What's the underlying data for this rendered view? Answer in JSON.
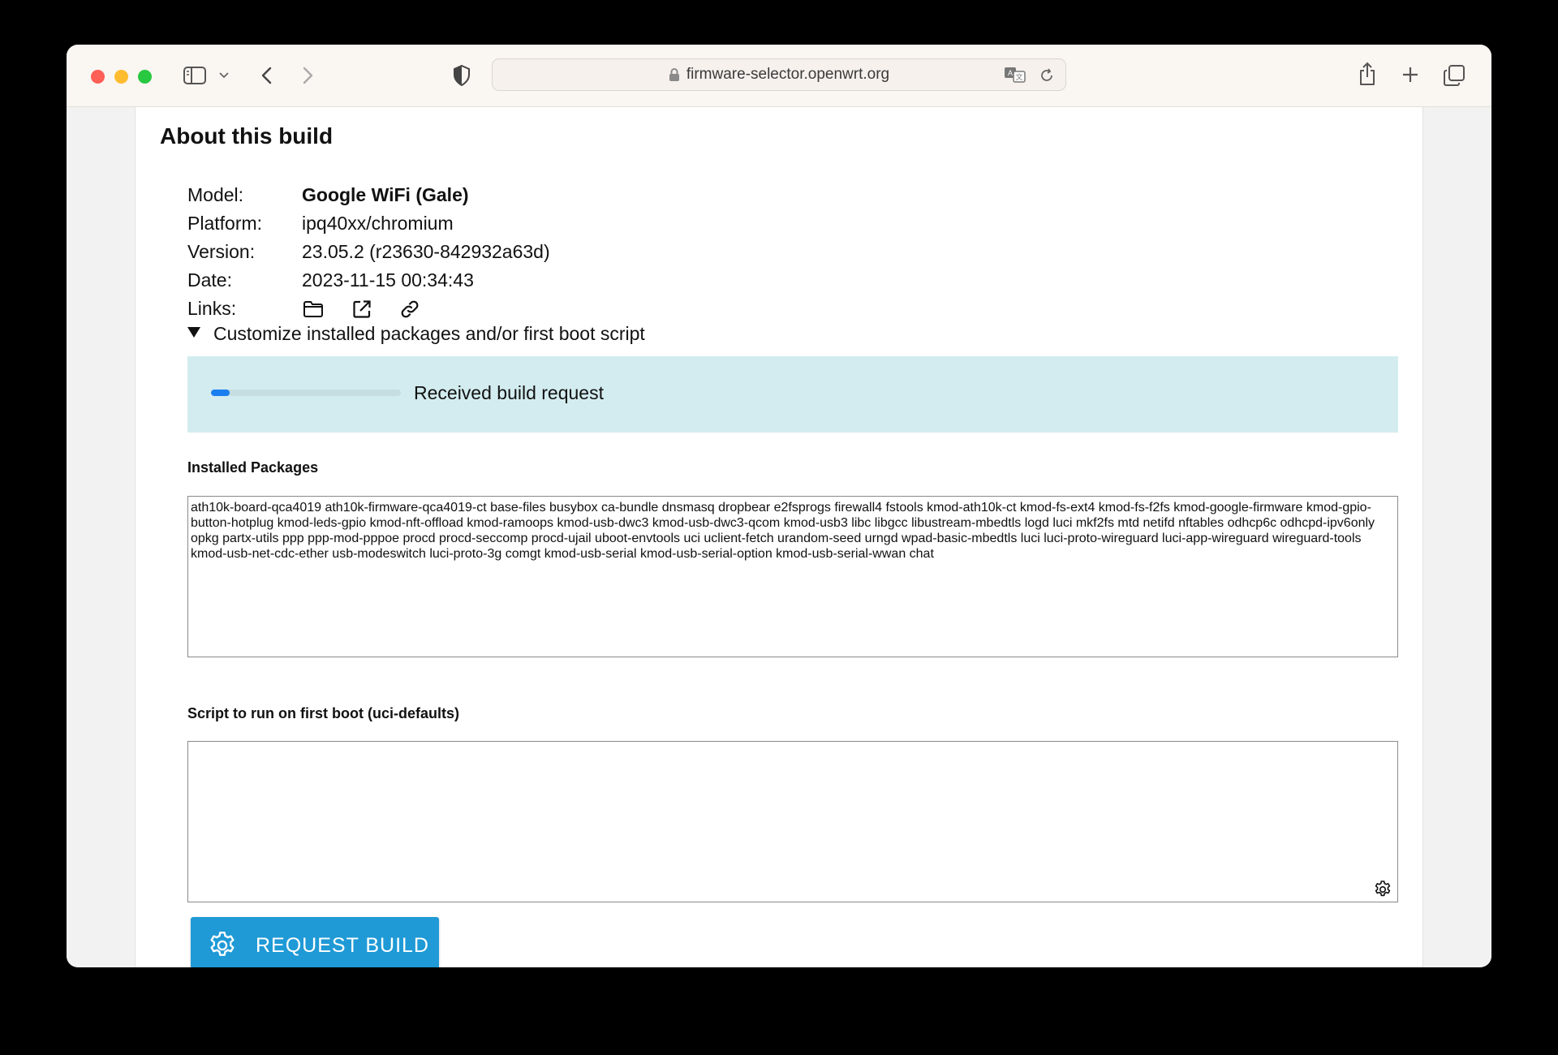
{
  "browser": {
    "url": "firmware-selector.openwrt.org",
    "colors": {
      "close": "#fe5f57",
      "minimize": "#febc2e",
      "zoom": "#28c840"
    },
    "icons": [
      "sidebar-icon",
      "chevron-down-icon",
      "back-icon",
      "forward-icon",
      "privacy-shield-icon",
      "lock-icon",
      "translate-icon",
      "reload-icon",
      "share-icon",
      "new-tab-icon",
      "tab-overview-icon"
    ]
  },
  "build": {
    "title": "About this build",
    "model_label": "Model:",
    "model_value": "Google WiFi (Gale)",
    "platform_label": "Platform:",
    "platform_value": "ipq40xx/chromium",
    "version_label": "Version:",
    "version_value": "23.05.2 (r23630-842932a63d)",
    "date_label": "Date:",
    "date_value": "2023-11-15 00:34:43",
    "links_label": "Links:",
    "link_icons": [
      "folder-icon",
      "external-link-icon",
      "chain-link-icon"
    ]
  },
  "customize": {
    "summary": "Customize installed packages and/or first boot script",
    "status_text": "Received build request",
    "progress_fraction": 0.1,
    "status_bg": "#d3ecef",
    "progress_color": "#1a7ef0",
    "packages_label": "Installed Packages",
    "packages_value": "ath10k-board-qca4019 ath10k-firmware-qca4019-ct base-files busybox ca-bundle dnsmasq dropbear e2fsprogs firewall4 fstools kmod-ath10k-ct kmod-fs-ext4 kmod-fs-f2fs kmod-google-firmware kmod-gpio-button-hotplug kmod-leds-gpio kmod-nft-offload kmod-ramoops kmod-usb-dwc3 kmod-usb-dwc3-qcom kmod-usb3 libc libgcc libustream-mbedtls logd luci mkf2fs mtd netifd nftables odhcp6c odhcpd-ipv6only opkg partx-utils ppp ppp-mod-pppoe procd procd-seccomp procd-ujail uboot-envtools uci uclient-fetch urandom-seed urngd wpad-basic-mbedtls luci luci-proto-wireguard luci-app-wireguard wireguard-tools kmod-usb-net-cdc-ether usb-modeswitch luci-proto-3g comgt kmod-usb-serial kmod-usb-serial-option kmod-usb-serial-wwan chat",
    "script_label": "Script to run on first boot (uci-defaults)",
    "script_value": "",
    "request_button": "REQUEST BUILD",
    "button_color": "#1f9ad6"
  }
}
